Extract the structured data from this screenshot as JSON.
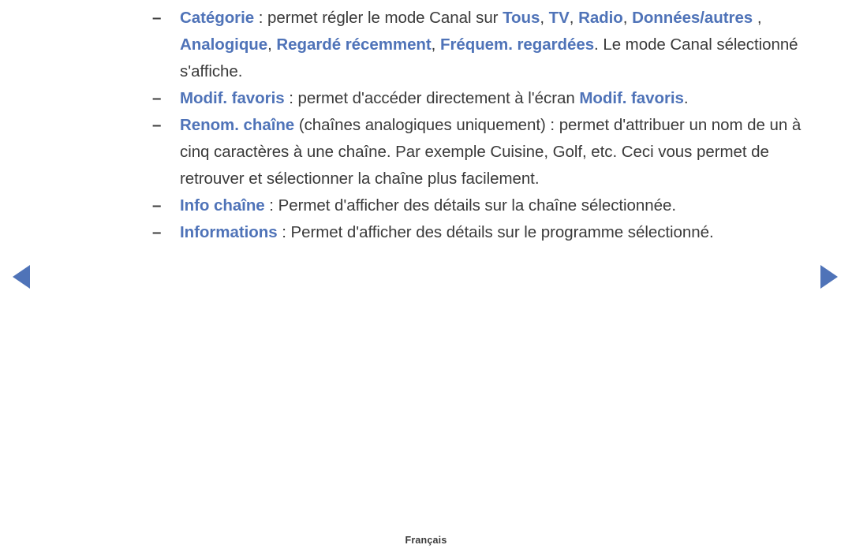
{
  "page": {
    "language_footer": "Français",
    "accent_color": "#4f73b8",
    "body_text_color": "#3a3a3a",
    "background_color": "#ffffff"
  },
  "navigation": {
    "prev_label": "◀",
    "prev_icon": "triangle-left-icon",
    "next_label": "▶",
    "next_icon": "triangle-right-icon"
  },
  "bullets": [
    {
      "marker": "–",
      "term": "Catégorie",
      "segments": [
        {
          "text": " : permet régler le mode Canal sur ",
          "style": "plain"
        },
        {
          "text": "Tous",
          "style": "term"
        },
        {
          "text": ", ",
          "style": "plain"
        },
        {
          "text": "TV",
          "style": "term"
        },
        {
          "text": ", ",
          "style": "plain"
        },
        {
          "text": "Radio",
          "style": "term"
        },
        {
          "text": ", ",
          "style": "plain"
        },
        {
          "text": "Données/autres",
          "style": "term"
        },
        {
          "text": " , ",
          "style": "plain"
        },
        {
          "text": "Analogique",
          "style": "term"
        },
        {
          "text": ", ",
          "style": "plain"
        },
        {
          "text": "Regardé récemment",
          "style": "term"
        },
        {
          "text": ", ",
          "style": "plain"
        },
        {
          "text": "Fréquem. regardées",
          "style": "term"
        },
        {
          "text": ". Le mode Canal sélectionné s'affiche.",
          "style": "plain"
        }
      ]
    },
    {
      "marker": "–",
      "term": "Modif. favoris",
      "segments": [
        {
          "text": " : permet d'accéder directement à l'écran ",
          "style": "plain"
        },
        {
          "text": "Modif. favoris",
          "style": "term"
        },
        {
          "text": ".",
          "style": "plain"
        }
      ]
    },
    {
      "marker": "–",
      "term": "Renom. chaîne",
      "segments": [
        {
          "text": " (chaînes analogiques uniquement) : permet d'attribuer un nom de un à cinq caractères à une chaîne. Par exemple Cuisine, Golf, etc. Ceci vous permet de retrouver et sélectionner la chaîne plus facilement.",
          "style": "plain"
        }
      ]
    },
    {
      "marker": "–",
      "term": "Info chaîne",
      "segments": [
        {
          "text": " : Permet d'afficher des détails sur la chaîne sélectionnée.",
          "style": "plain"
        }
      ]
    },
    {
      "marker": "–",
      "term": "Informations",
      "segments": [
        {
          "text": " : Permet d'afficher des détails sur le programme sélectionné.",
          "style": "plain"
        }
      ]
    }
  ]
}
